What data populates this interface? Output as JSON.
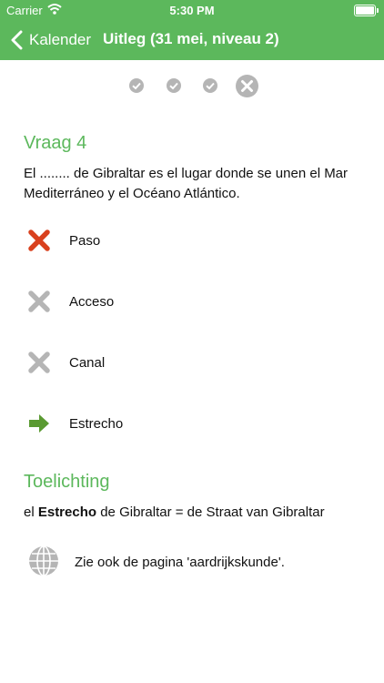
{
  "status": {
    "carrier": "Carrier",
    "time": "5:30 PM"
  },
  "nav": {
    "back_label": "Kalender",
    "title": "Uitleg (31 mei, niveau 2)"
  },
  "progress": [
    "correct",
    "correct",
    "correct",
    "wrong-current"
  ],
  "question": {
    "heading": "Vraag 4",
    "text": "El ........ de Gibraltar es el lugar donde se unen el Mar Mediterráneo y el Océano Atlántico."
  },
  "answers": [
    {
      "label": "Paso",
      "state": "wrong-chosen",
      "color": "#d9411e"
    },
    {
      "label": "Acceso",
      "state": "wrong",
      "color": "#b5b5b5"
    },
    {
      "label": "Canal",
      "state": "wrong",
      "color": "#b5b5b5"
    },
    {
      "label": "Estrecho",
      "state": "correct",
      "color": "#5a9a32"
    }
  ],
  "explanation": {
    "heading": "Toelichting",
    "prefix": "el ",
    "bold": "Estrecho",
    "suffix": " de Gibraltar = de Straat van Gibraltar"
  },
  "see_also": {
    "text": "Zie ook de pagina 'aardrijkskunde'."
  },
  "colors": {
    "accent": "#5cb85c",
    "wrong": "#d9411e",
    "neutral": "#b5b5b5",
    "correct": "#5a9a32"
  }
}
